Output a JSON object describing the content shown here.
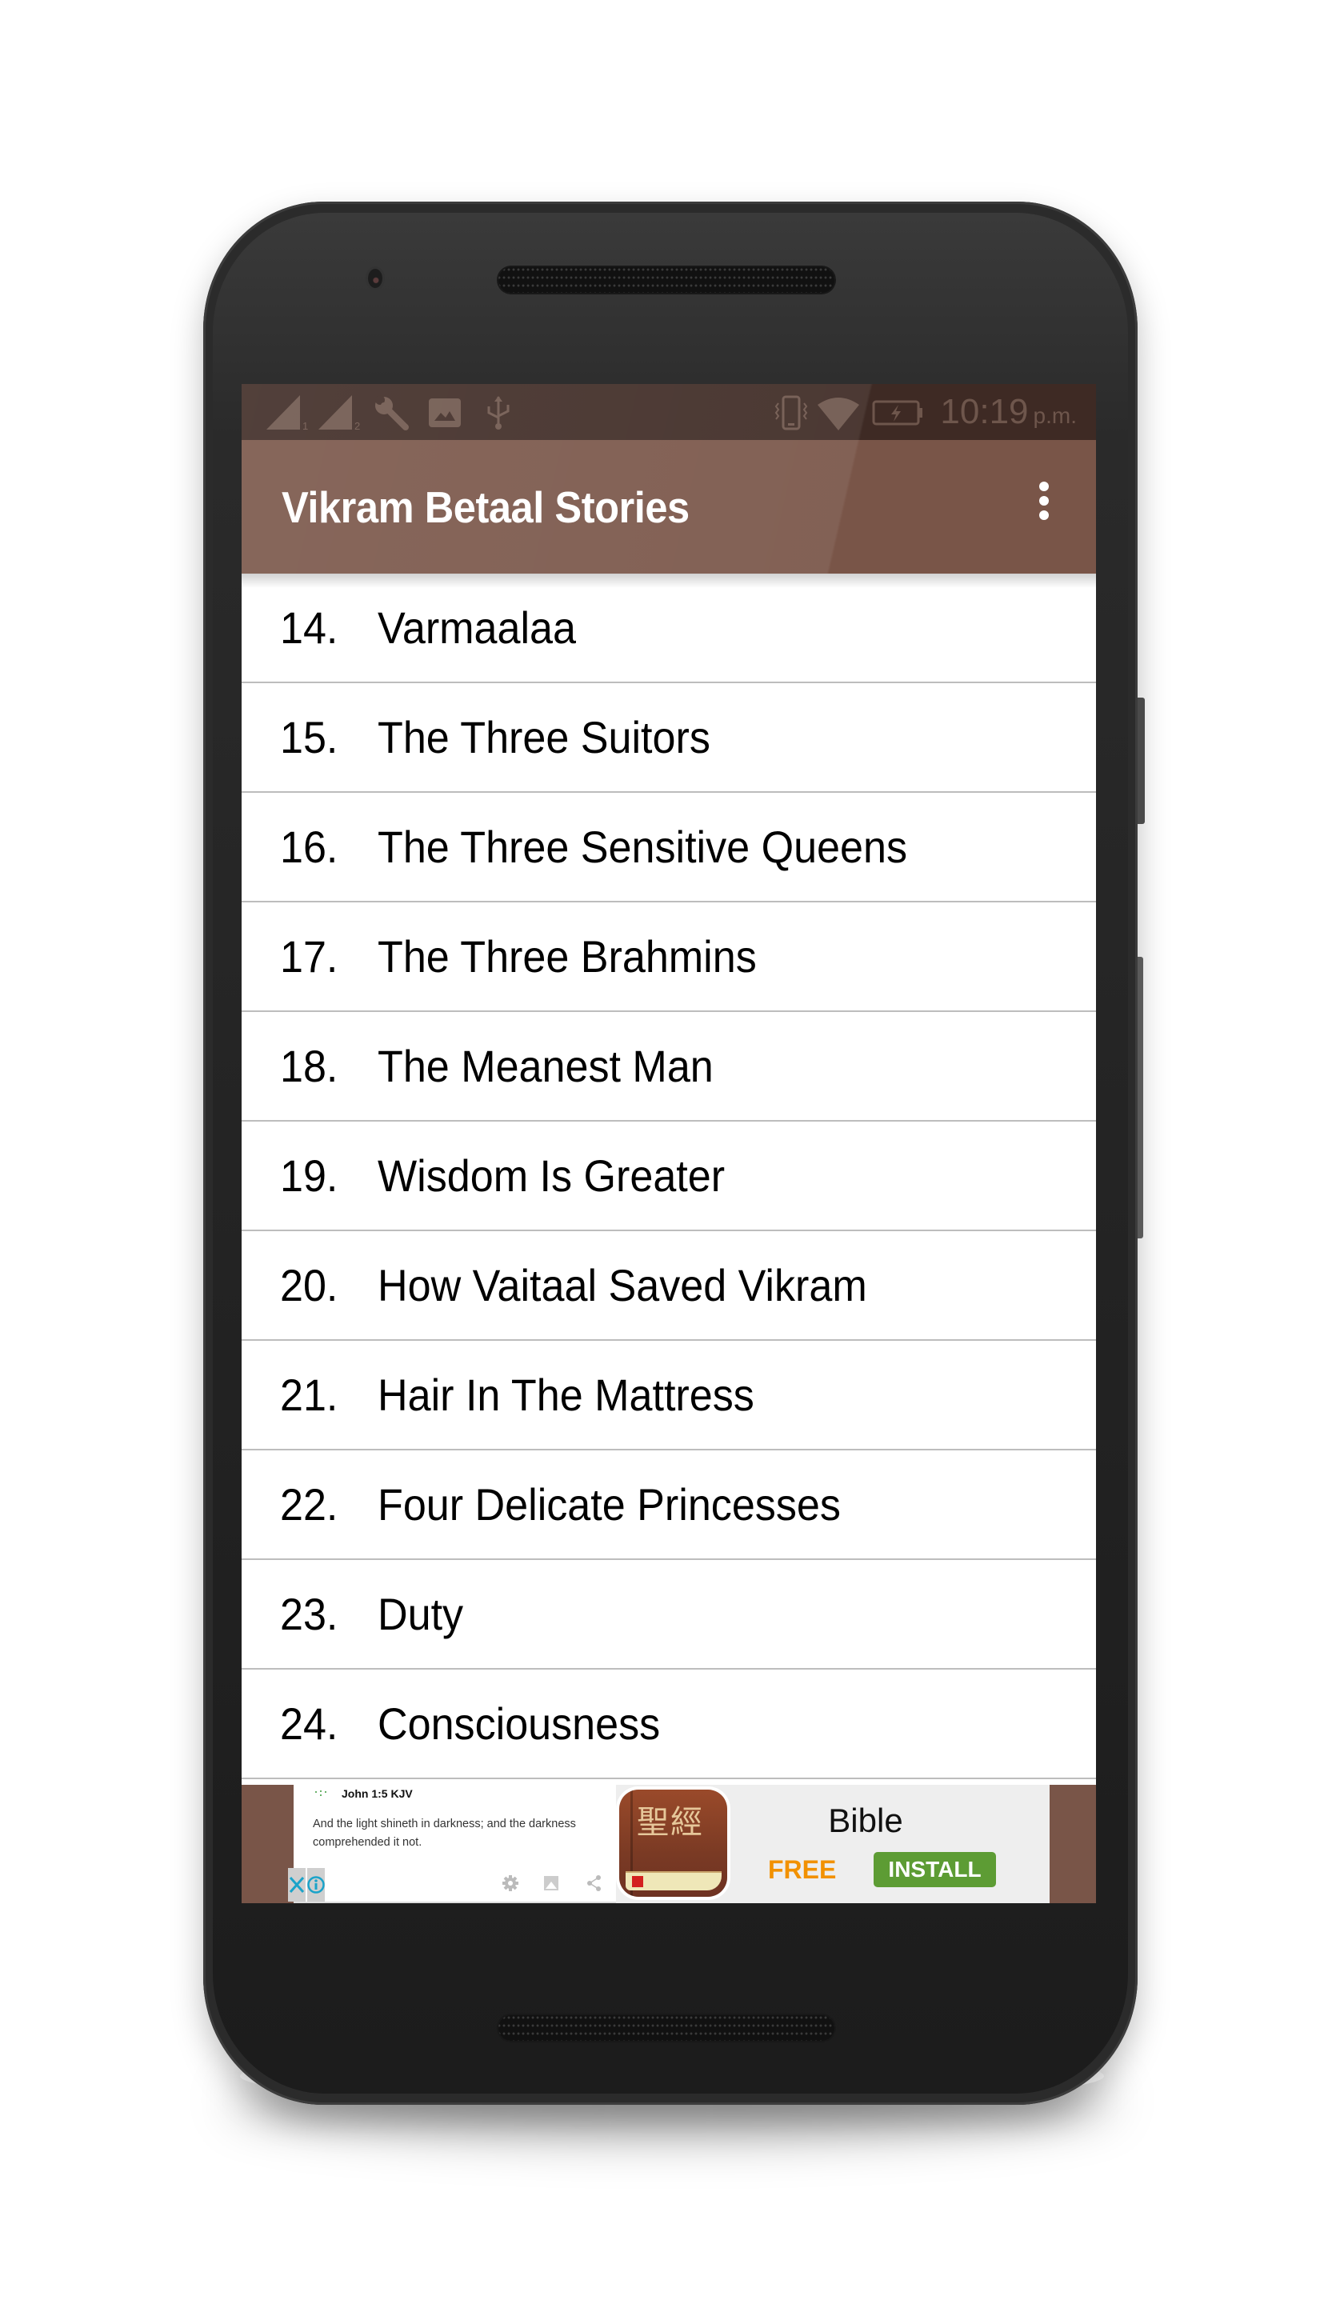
{
  "status_bar": {
    "left_icons": [
      "signal-sim1-icon",
      "signal-sim2-icon",
      "wrench-icon",
      "image-icon",
      "usb-icon"
    ],
    "sim1_label": "1",
    "sim2_label": "2",
    "right_icons": [
      "vibrate-icon",
      "wifi-icon",
      "battery-charging-icon"
    ],
    "time": "10:19",
    "ampm": "p.m."
  },
  "toolbar": {
    "title": "Vikram Betaal Stories",
    "menu_icon": "more-vertical-icon"
  },
  "stories": [
    {
      "num": "14.",
      "title": "Varmaalaa"
    },
    {
      "num": "15.",
      "title": "The Three Suitors"
    },
    {
      "num": "16.",
      "title": "The Three Sensitive Queens"
    },
    {
      "num": "17.",
      "title": "The Three Brahmins"
    },
    {
      "num": "18.",
      "title": "The Meanest Man"
    },
    {
      "num": "19.",
      "title": "Wisdom Is Greater"
    },
    {
      "num": "20.",
      "title": "How Vaitaal Saved Vikram"
    },
    {
      "num": "21.",
      "title": "Hair In The Mattress"
    },
    {
      "num": "22.",
      "title": "Four Delicate Princesses"
    },
    {
      "num": "23.",
      "title": "Duty"
    },
    {
      "num": "24.",
      "title": "Consciousness"
    }
  ],
  "ad": {
    "verse_ref": "John 1:5 KJV",
    "verse_text": "And the light shineth in darkness; and the darkness comprehended it not.",
    "icon_chars": "聖經",
    "app_name": "Bible",
    "price": "FREE",
    "install_label": "INSTALL",
    "close_label": "X",
    "info_label": "i"
  },
  "colors": {
    "primary": "#795548",
    "status_bar": "#3e2a24",
    "install_green": "#5d9c34",
    "free_orange": "#f29100",
    "ad_close_blue": "#1aa3c9"
  }
}
